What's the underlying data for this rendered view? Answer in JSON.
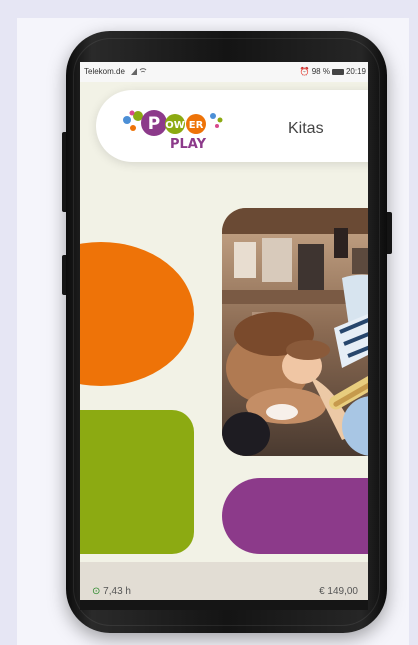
{
  "status_bar": {
    "carrier": "Telekom.de",
    "battery_text": "98 %",
    "time": "20:19"
  },
  "header": {
    "logo_top": "POWER",
    "logo_letters": [
      "P",
      "OW",
      "ER"
    ],
    "logo_bottom": "PLAY",
    "nav_label": "Kitas"
  },
  "footer": {
    "duration": "7,43 h",
    "price": "€ 149,00"
  },
  "colors": {
    "orange": "#ee7308",
    "green": "#8caa12",
    "purple": "#8c3a8a",
    "screen_bg": "#f2f2e6"
  },
  "icons": [
    "signal-icon",
    "wifi-icon",
    "alarm-icon",
    "battery-icon",
    "more-vert-icon",
    "clock-icon"
  ]
}
